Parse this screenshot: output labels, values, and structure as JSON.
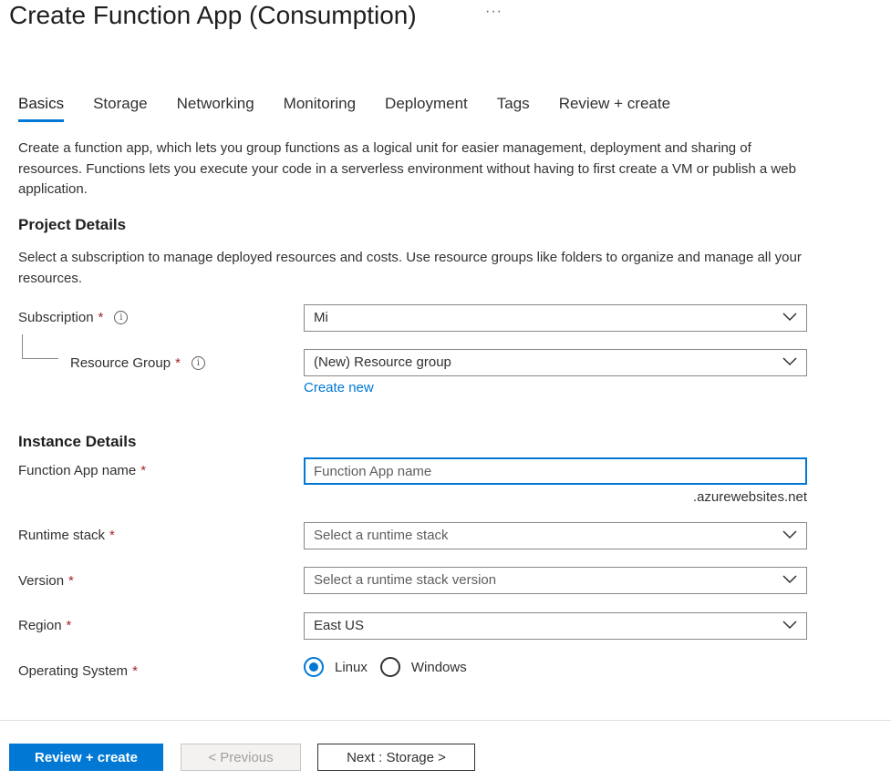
{
  "page": {
    "title": "Create Function App (Consumption)",
    "more": "···"
  },
  "tabs": [
    {
      "label": "Basics",
      "active": true
    },
    {
      "label": "Storage"
    },
    {
      "label": "Networking"
    },
    {
      "label": "Monitoring"
    },
    {
      "label": "Deployment"
    },
    {
      "label": "Tags"
    },
    {
      "label": "Review + create"
    }
  ],
  "intro": "Create a function app, which lets you group functions as a logical unit for easier management, deployment and sharing of resources. Functions lets you execute your code in a serverless environment without having to first create a VM or publish a web application.",
  "project": {
    "heading": "Project Details",
    "description": "Select a subscription to manage deployed resources and costs. Use resource groups like folders to organize and manage all your resources.",
    "subscription_label": "Subscription",
    "subscription_value": "Mi",
    "resource_group_label": "Resource Group",
    "resource_group_value": "(New) Resource group",
    "create_new": "Create new"
  },
  "instance": {
    "heading": "Instance Details",
    "app_name_label": "Function App name",
    "app_name_placeholder": "Function App name",
    "app_name_value": "",
    "suffix": ".azurewebsites.net",
    "runtime_label": "Runtime stack",
    "runtime_value": "Select a runtime stack",
    "version_label": "Version",
    "version_value": "Select a runtime stack version",
    "region_label": "Region",
    "region_value": "East US",
    "os_label": "Operating System",
    "os_options": [
      {
        "label": "Linux",
        "checked": true
      },
      {
        "label": "Windows",
        "checked": false
      }
    ]
  },
  "required_mark": "*",
  "info_glyph": "i",
  "footer": {
    "review_create": "Review + create",
    "previous": "< Previous",
    "next": "Next : Storage >"
  },
  "colors": {
    "accent": "#0078d4",
    "required": "#a4262c"
  }
}
